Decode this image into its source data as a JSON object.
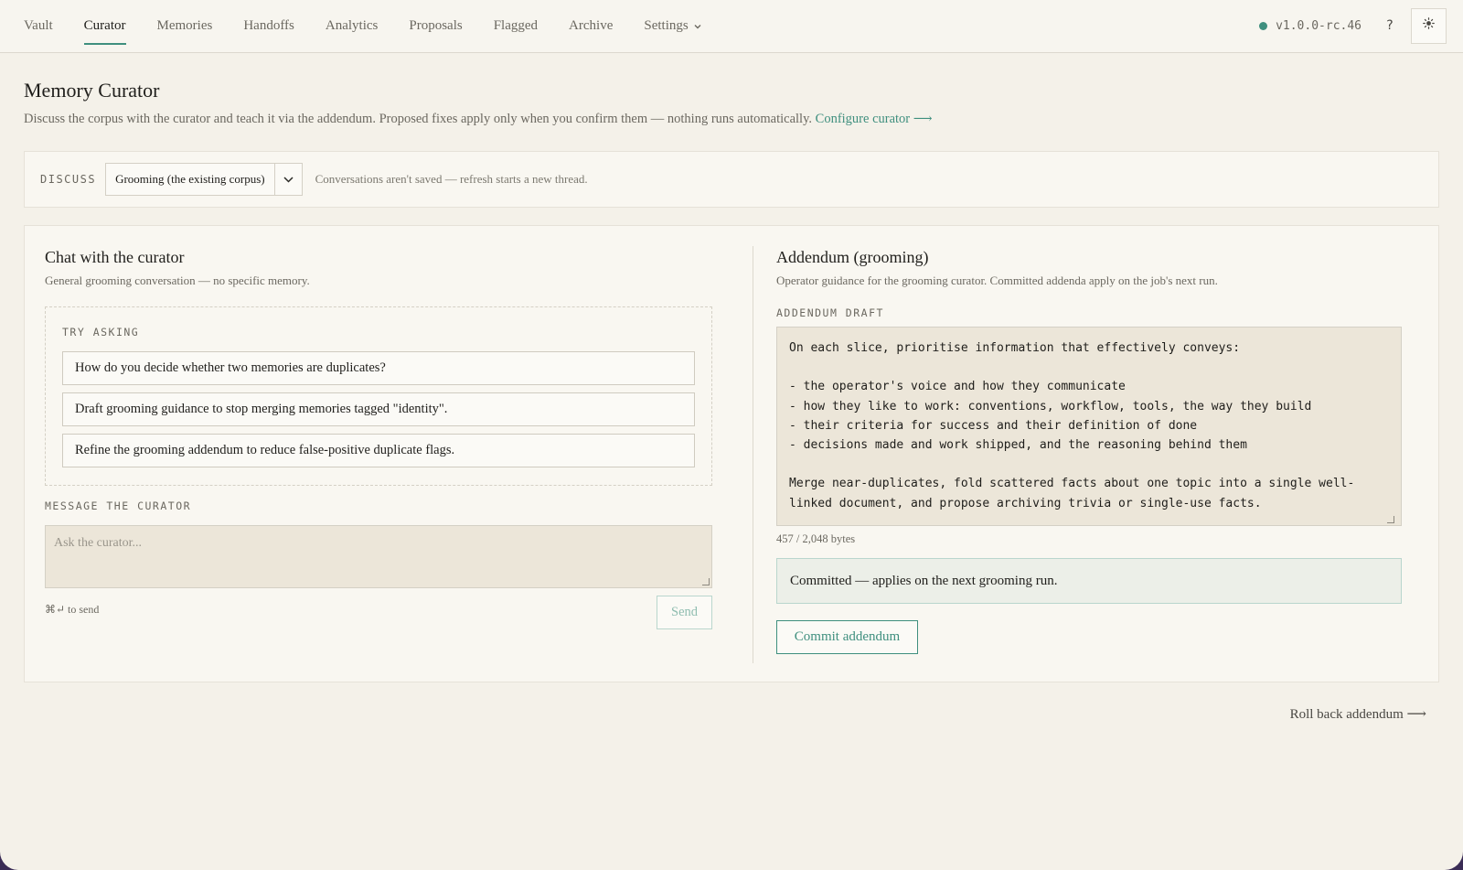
{
  "nav": {
    "tabs": [
      {
        "label": "Vault"
      },
      {
        "label": "Curator"
      },
      {
        "label": "Memories"
      },
      {
        "label": "Handoffs"
      },
      {
        "label": "Analytics"
      },
      {
        "label": "Proposals"
      },
      {
        "label": "Flagged"
      },
      {
        "label": "Archive"
      },
      {
        "label": "Settings"
      }
    ],
    "active_tab": "Curator",
    "version": "v1.0.0-rc.46",
    "help_label": "?",
    "theme_icon": "sun-icon",
    "status_color": "#3f8f7e"
  },
  "page": {
    "title": "Memory Curator",
    "description": "Discuss the corpus with the curator and teach it via the addendum. Proposed fixes apply only when you confirm them — nothing runs automatically.",
    "configure_link": "Configure curator ⟶"
  },
  "discuss": {
    "label": "DISCUSS",
    "selected": "Grooming (the existing corpus)",
    "note": "Conversations aren't saved — refresh starts a new thread."
  },
  "chat": {
    "title": "Chat with the curator",
    "subtitle": "General grooming conversation — no specific memory.",
    "try_label": "TRY ASKING",
    "suggestions": [
      "How do you decide whether two memories are duplicates?",
      "Draft grooming guidance to stop merging memories tagged \"identity\".",
      "Refine the grooming addendum to reduce false-positive duplicate flags."
    ],
    "message_label": "MESSAGE THE CURATOR",
    "placeholder": "Ask the curator...",
    "send_hint": "⌘↵ to send",
    "send_label": "Send"
  },
  "addendum": {
    "title": "Addendum (grooming)",
    "subtitle": "Operator guidance for the grooming curator. Committed addenda apply on the job's next run.",
    "draft_label": "ADDENDUM DRAFT",
    "draft_text": "On each slice, prioritise information that effectively conveys:\n\n- the operator's voice and how they communicate\n- how they like to work: conventions, workflow, tools, the way they build\n- their criteria for success and their definition of done\n- decisions made and work shipped, and the reasoning behind them\n\nMerge near-duplicates, fold scattered facts about one topic into a single well-linked document, and propose archiving trivia or single-use facts.",
    "byte_count": "457 / 2,048 bytes",
    "commit_message": "Committed — applies on the next grooming run.",
    "commit_label": "Commit addendum"
  },
  "footer": {
    "rollback_label": "Roll back addendum ⟶"
  },
  "colors": {
    "accent": "#3f8f7e",
    "background": "#f4f1e9",
    "frame": "#3a2c55"
  }
}
